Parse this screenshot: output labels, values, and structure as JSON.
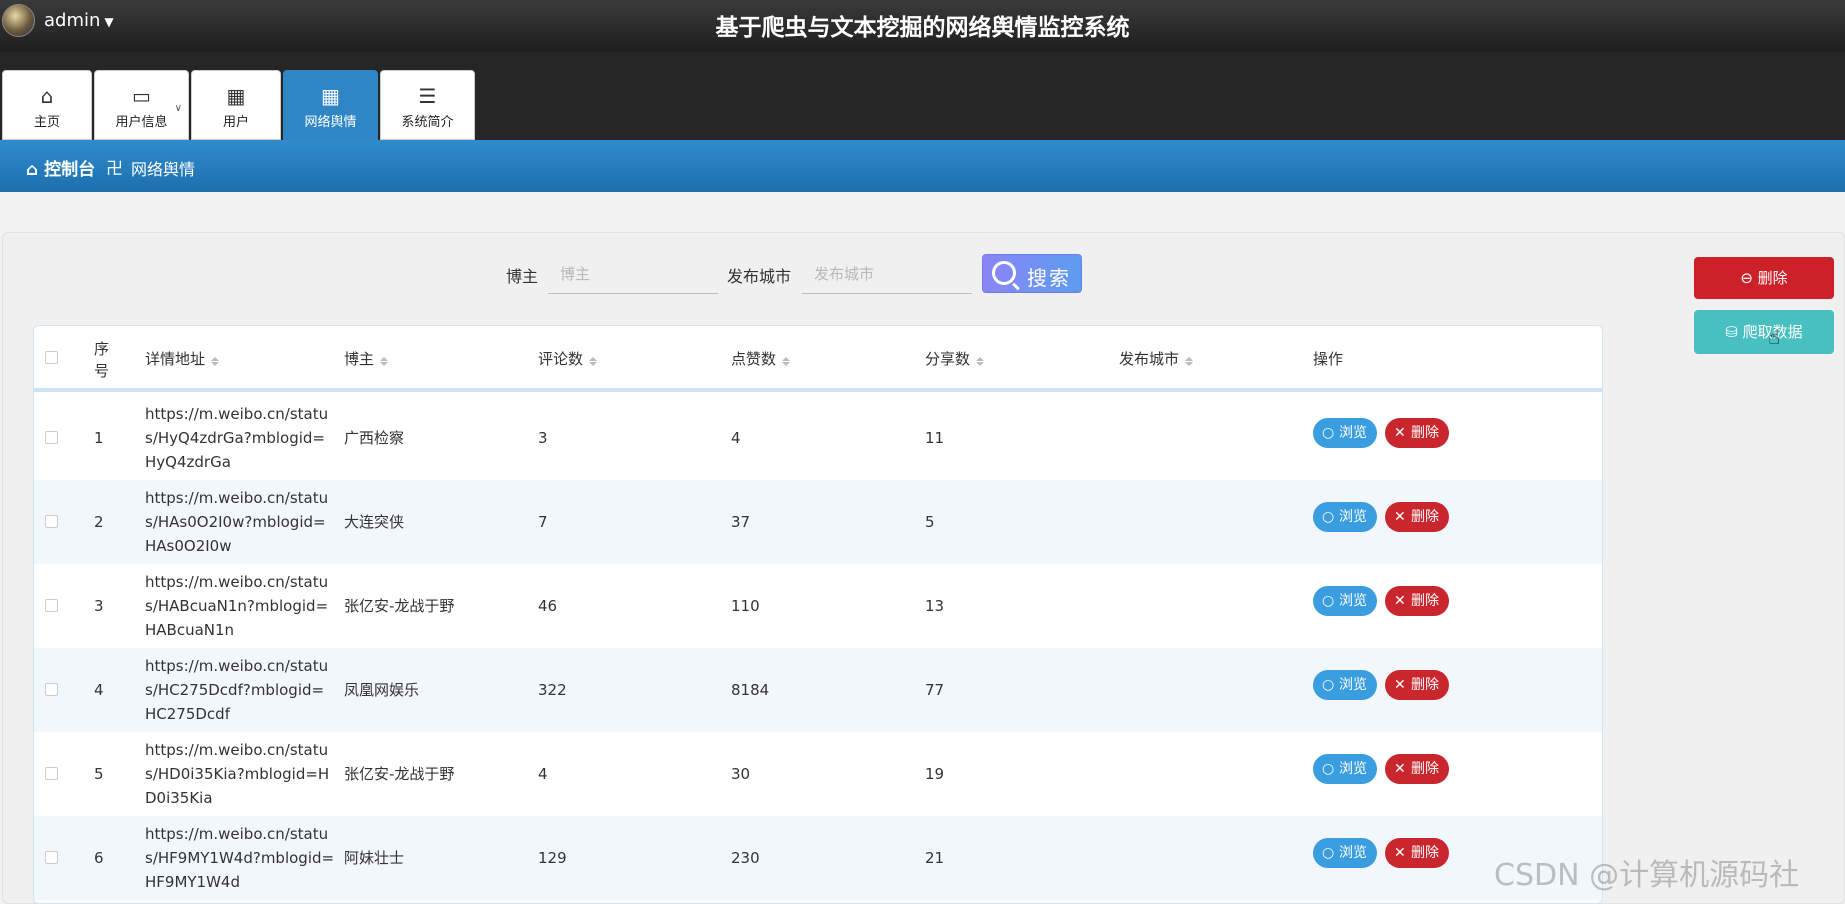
{
  "header": {
    "user": "admin",
    "title": "基于爬虫与文本挖掘的网络舆情监控系统"
  },
  "nav": [
    {
      "label": "主页",
      "icon": "home-icon"
    },
    {
      "label": "用户信息",
      "icon": "card-icon"
    },
    {
      "label": "用户",
      "icon": "grid-icon"
    },
    {
      "label": "网络舆情",
      "icon": "grid-icon",
      "active": true
    },
    {
      "label": "系统简介",
      "icon": "list-icon"
    }
  ],
  "breadcrumb": {
    "home": "控制台",
    "separator": "卍",
    "current": "网络舆情"
  },
  "search": {
    "blogger_label": "博主",
    "blogger_placeholder": "博主",
    "city_label": "发布城市",
    "city_placeholder": "发布城市",
    "button": "搜索"
  },
  "side_buttons": {
    "delete": "删除",
    "crawl": "爬取数据"
  },
  "table": {
    "columns": [
      "序号",
      "详情地址",
      "博主",
      "评论数",
      "点赞数",
      "分享数",
      "发布城市",
      "操作"
    ],
    "rows": [
      {
        "no": "1",
        "url": "https://m.weibo.cn/status/HyQ4zdrGa?mblogid=HyQ4zdrGa",
        "blogger": "广西检察",
        "comments": "3",
        "likes": "4",
        "shares": "11",
        "city": ""
      },
      {
        "no": "2",
        "url": "https://m.weibo.cn/status/HAs0O2I0w?mblogid=HAs0O2I0w",
        "blogger": "大连突侠",
        "comments": "7",
        "likes": "37",
        "shares": "5",
        "city": ""
      },
      {
        "no": "3",
        "url": "https://m.weibo.cn/status/HABcuaN1n?mblogid=HABcuaN1n",
        "blogger": "张亿安-龙战于野",
        "comments": "46",
        "likes": "110",
        "shares": "13",
        "city": ""
      },
      {
        "no": "4",
        "url": "https://m.weibo.cn/status/HC275Dcdf?mblogid=HC275Dcdf",
        "blogger": "凤凰网娱乐",
        "comments": "322",
        "likes": "8184",
        "shares": "77",
        "city": ""
      },
      {
        "no": "5",
        "url": "https://m.weibo.cn/status/HD0i35Kia?mblogid=HD0i35Kia",
        "blogger": "张亿安-龙战于野",
        "comments": "4",
        "likes": "30",
        "shares": "19",
        "city": ""
      },
      {
        "no": "6",
        "url": "https://m.weibo.cn/status/HF9MY1W4d?mblogid=HF9MY1W4d",
        "blogger": "阿妹壮士",
        "comments": "129",
        "likes": "230",
        "shares": "21",
        "city": ""
      }
    ],
    "view_label": "浏览",
    "delete_label": "删除"
  },
  "watermark": "CSDN @计算机源码社"
}
